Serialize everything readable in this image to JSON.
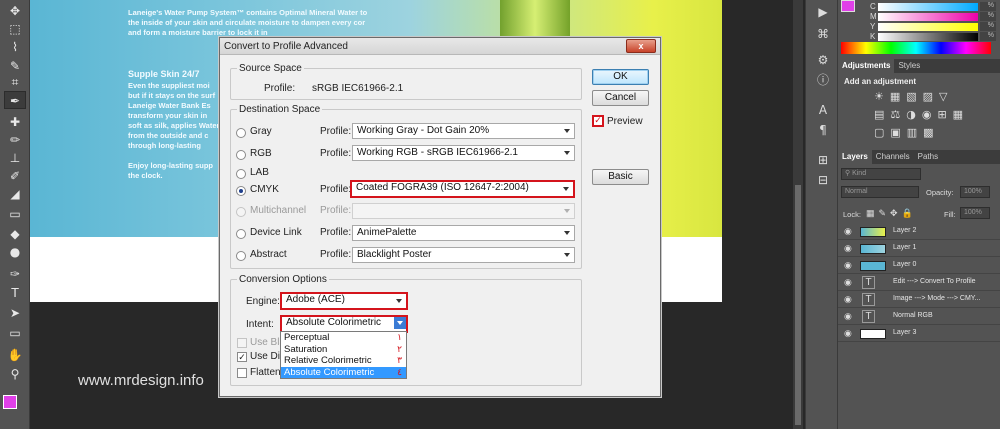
{
  "dialog": {
    "title": "Convert to Profile Advanced",
    "close_label": "x",
    "source_space": {
      "legend": "Source Space",
      "profile_label": "Profile:",
      "profile_value": "sRGB IEC61966-2.1"
    },
    "destination_space": {
      "legend": "Destination Space",
      "profile_label": "Profile:",
      "rows": [
        {
          "mode": "Gray",
          "profile": "Working Gray - Dot Gain 20%",
          "selected": false,
          "enabled": true,
          "highlighted": false
        },
        {
          "mode": "RGB",
          "profile": "Working RGB - sRGB IEC61966-2.1",
          "selected": false,
          "enabled": true,
          "highlighted": false
        },
        {
          "mode": "LAB",
          "profile": "",
          "selected": false,
          "enabled": true,
          "highlighted": false
        },
        {
          "mode": "CMYK",
          "profile": "Coated FOGRA39 (ISO 12647-2:2004)",
          "selected": true,
          "enabled": true,
          "highlighted": true
        },
        {
          "mode": "Multichannel",
          "profile": "",
          "selected": false,
          "enabled": false,
          "highlighted": false
        },
        {
          "mode": "Device Link",
          "profile": "AnimePalette",
          "selected": false,
          "enabled": true,
          "highlighted": false
        },
        {
          "mode": "Abstract",
          "profile": "Blacklight Poster",
          "selected": false,
          "enabled": true,
          "highlighted": false
        }
      ]
    },
    "conversion_options": {
      "legend": "Conversion Options",
      "engine_label": "Engine:",
      "engine_value": "Adobe (ACE)",
      "intent_label": "Intent:",
      "intent_value": "Absolute Colorimetric",
      "intent_options": [
        {
          "label": "Perceptual",
          "number": "١",
          "selected": false
        },
        {
          "label": "Saturation",
          "number": "٢",
          "selected": false
        },
        {
          "label": "Relative Colorimetric",
          "number": "٣",
          "selected": false
        },
        {
          "label": "Absolute Colorimetric",
          "number": "٤",
          "selected": true
        }
      ],
      "use_black_point_label": "Use Bla",
      "use_dither_label": "Use Dith",
      "flatten_label": "Flatten"
    },
    "buttons": {
      "ok": "OK",
      "cancel": "Cancel",
      "basic": "Basic"
    },
    "preview_label": "Preview"
  },
  "canvas": {
    "watermark": "www.mrdesign.info",
    "photo_text_1": "Laneige's Water Pump System™ contains Optimal Mineral Water to\nthe inside of your skin and circulate moisture to dampen every cor\nand form a moisture barrier to lock it in",
    "photo_heading": "Supple Skin 24/7",
    "photo_text_2": "Even the suppliest moi\nbut if it stays on the surf\nLaneige Water Bank Es\ntransform your skin in\nsoft as silk, applies Water\nfrom the outside and c\nthrough long-lasting",
    "photo_text_3": "Enjoy long-lasting supp\nthe clock."
  },
  "color_panel": {
    "labels": [
      "C",
      "M",
      "Y",
      "K"
    ],
    "values": [
      "%",
      "%",
      "%",
      "%"
    ]
  },
  "adjustments_panel": {
    "tabs": [
      "Adjustments",
      "Styles"
    ],
    "title": "Add an adjustment"
  },
  "layers_panel": {
    "tabs": [
      "Layers",
      "Channels",
      "Paths"
    ],
    "filter_label": "Kind",
    "blend_mode": "Normal",
    "opacity_label": "Opacity:",
    "opacity_value": "100%",
    "lock_label": "Lock:",
    "fill_label": "Fill:",
    "fill_value": "100%",
    "layers": [
      {
        "name": "Layer 2",
        "type": "image"
      },
      {
        "name": "Layer 1",
        "type": "image"
      },
      {
        "name": "Layer 0",
        "type": "image"
      },
      {
        "name": "Edit ---> Convert To Profile",
        "type": "text"
      },
      {
        "name": "Image ---> Mode ---> CMY...",
        "type": "text"
      },
      {
        "name": "Normal RGB",
        "type": "text"
      },
      {
        "name": "Layer 3",
        "type": "image"
      }
    ]
  },
  "colors": {
    "highlight_red": "#d4141c",
    "selection_blue": "#3399ff",
    "foreground_swatch": "#e040e8"
  }
}
